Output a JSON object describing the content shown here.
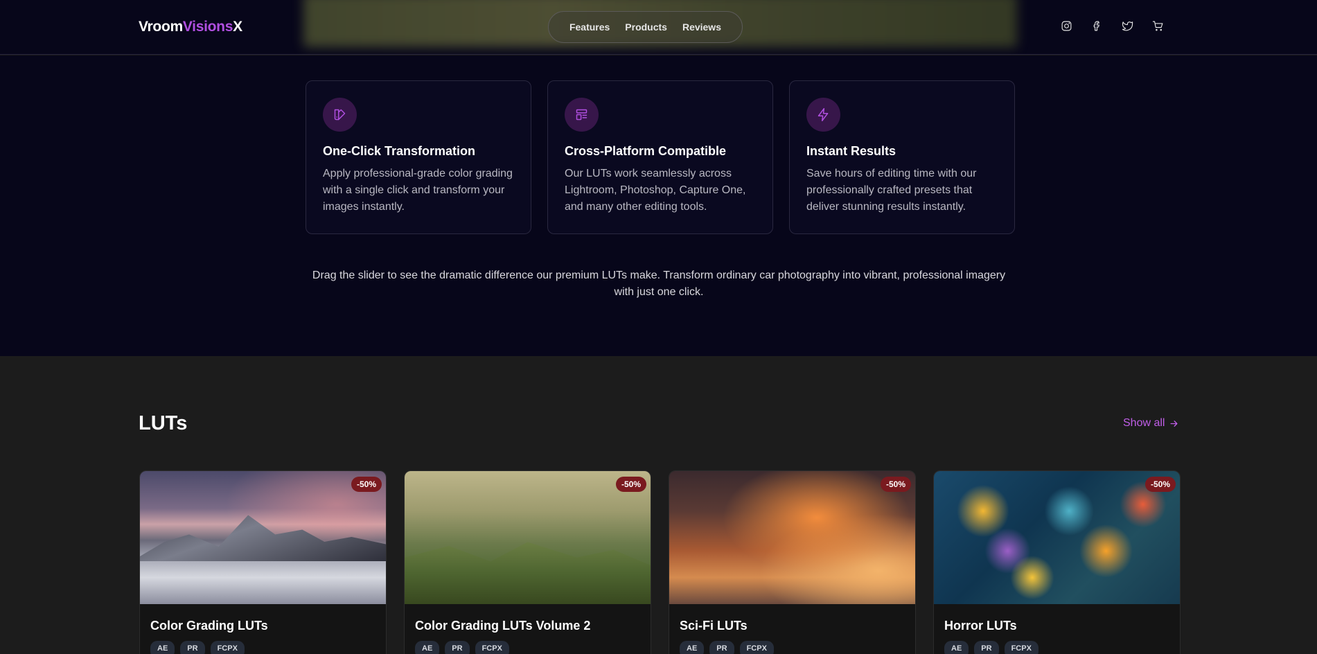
{
  "brand": {
    "part1": "Vroom",
    "part2": "Visions",
    "part3": "X"
  },
  "nav": {
    "items": [
      "Features",
      "Products",
      "Reviews"
    ]
  },
  "header_icons": [
    "instagram-icon",
    "facebook-icon",
    "twitter-icon",
    "cart-icon"
  ],
  "features": [
    {
      "icon": "palette-swatch-icon",
      "title": "One-Click Transformation",
      "description": "Apply professional-grade color grading with a single click and transform your images instantly."
    },
    {
      "icon": "layout-icon",
      "title": "Cross-Platform Compatible",
      "description": "Our LUTs work seamlessly across Lightroom, Photoshop, Capture One, and many other editing tools."
    },
    {
      "icon": "lightning-icon",
      "title": "Instant Results",
      "description": "Save hours of editing time with our professionally crafted presets that deliver stunning results instantly."
    }
  ],
  "tagline": "Drag the slider to see the dramatic difference our premium LUTs make. Transform ordinary car photography into vibrant, professional imagery with just one click.",
  "luts": {
    "title": "LUTs",
    "show_all": "Show all",
    "products": [
      {
        "name": "Color Grading LUTs",
        "badge": "-50%",
        "tags": [
          "AE",
          "PR",
          "FCPX"
        ]
      },
      {
        "name": "Color Grading LUTs Volume 2",
        "badge": "-50%",
        "tags": [
          "AE",
          "PR",
          "FCPX"
        ]
      },
      {
        "name": "Sci-Fi LUTs",
        "badge": "-50%",
        "tags": [
          "AE",
          "PR",
          "FCPX"
        ]
      },
      {
        "name": "Horror LUTs",
        "badge": "-50%",
        "tags": [
          "AE",
          "PR",
          "FCPX"
        ]
      }
    ]
  },
  "colors": {
    "accent": "#b04fe0",
    "badge": "#7a1a1f",
    "hero_bg": "#07061a",
    "section_bg": "#1c1c1c"
  }
}
